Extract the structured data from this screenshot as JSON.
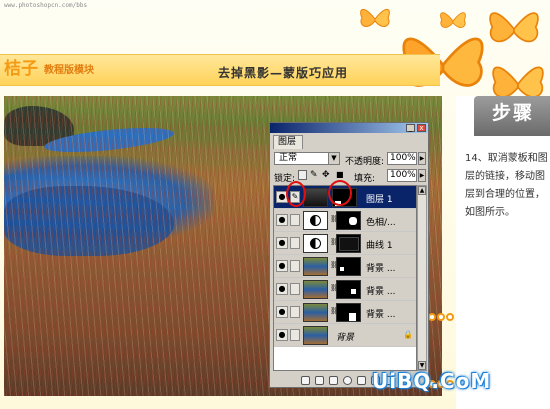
{
  "site": {
    "url": "www.photoshopcn.com/bbs"
  },
  "header": {
    "brand": "桔子",
    "brand_sub": "教程版模块",
    "title": "去掉黑影—蒙版巧应用"
  },
  "step": {
    "title": "步骤",
    "text": "14、取消蒙板和图层的链接，移动图层到合理的位置，如图所示。"
  },
  "layers_panel": {
    "tab_label": "图层",
    "blend_mode": "正常",
    "opacity_label": "不透明度:",
    "opacity_value": "100%",
    "lock_label": "锁定:",
    "fill_label": "填充:",
    "fill_value": "100%",
    "layers": [
      {
        "name": "图层 1",
        "selected": true,
        "thumb": "photo",
        "mask": true
      },
      {
        "name": "色相/...",
        "selected": false,
        "thumb": "adjustment",
        "mask": true
      },
      {
        "name": "曲线 1",
        "selected": false,
        "thumb": "adjustment",
        "mask": true
      },
      {
        "name": "背景 ...",
        "selected": false,
        "thumb": "photo",
        "mask": true
      },
      {
        "name": "背景 ...",
        "selected": false,
        "thumb": "photo",
        "mask": true
      },
      {
        "name": "背景 ...",
        "selected": false,
        "thumb": "photo",
        "mask": true
      },
      {
        "name": "背景",
        "selected": false,
        "thumb": "photo",
        "mask": false,
        "italic": true,
        "locked": true
      }
    ]
  },
  "watermark": "UiBQ.CoM",
  "colors": {
    "accent": "#f59a13",
    "selection": "#0a246a",
    "highlight_circle": "#e01010"
  }
}
